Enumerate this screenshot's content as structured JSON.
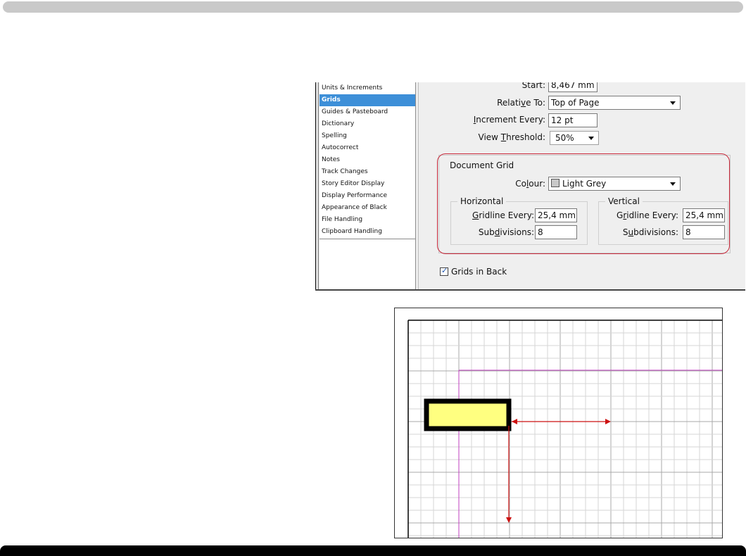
{
  "sidebar": {
    "items": [
      "Units & Increments",
      "Grids",
      "Guides & Pasteboard",
      "Dictionary",
      "Spelling",
      "Autocorrect",
      "Notes",
      "Track Changes",
      "Story Editor Display",
      "Display Performance",
      "Appearance of Black",
      "File Handling",
      "Clipboard Handling"
    ],
    "selected": "Grids"
  },
  "baseline": {
    "start_label": "Start:",
    "start_value": "8,467 mm",
    "relative_label_pre": "Relati",
    "relative_label_u": "v",
    "relative_label_post": "e To:",
    "relative_value": "Top of Page",
    "increment_label_u": "I",
    "increment_label_post": "ncrement Every:",
    "increment_value": "12 pt",
    "threshold_label_pre": "View ",
    "threshold_label_u": "T",
    "threshold_label_post": "hreshold:",
    "threshold_value": "50%"
  },
  "document_grid": {
    "title": "Document Grid",
    "colour_label_pre": "Co",
    "colour_label_u": "l",
    "colour_label_post": "our:",
    "colour_value": "Light Grey",
    "colour_swatch": "#c8c8c8",
    "horizontal": {
      "title": "Horizontal",
      "gridline_label_u": "G",
      "gridline_label_post": "ridline Every:",
      "gridline_value": "25,4 mm",
      "subdiv_label_pre": "Sub",
      "subdiv_label_u": "d",
      "subdiv_label_post": "ivisions:",
      "subdiv_value": "8"
    },
    "vertical": {
      "title": "Vertical",
      "gridline_label_pre": "G",
      "gridline_label_u": "r",
      "gridline_label_post": "idline Every:",
      "gridline_value": "25,4 mm",
      "subdiv_label_pre": "S",
      "subdiv_label_u": "u",
      "subdiv_label_post": "bdivisions:",
      "subdiv_value": "8"
    }
  },
  "grids_in_back": {
    "label": "Grids in Back",
    "checked": true
  },
  "colors": {
    "highlight": "#c8283a",
    "selection": "#3d8fd8",
    "margin_guide": "#c040c0",
    "arrow": "#cc1111",
    "frame_fill": "#ffff80"
  }
}
